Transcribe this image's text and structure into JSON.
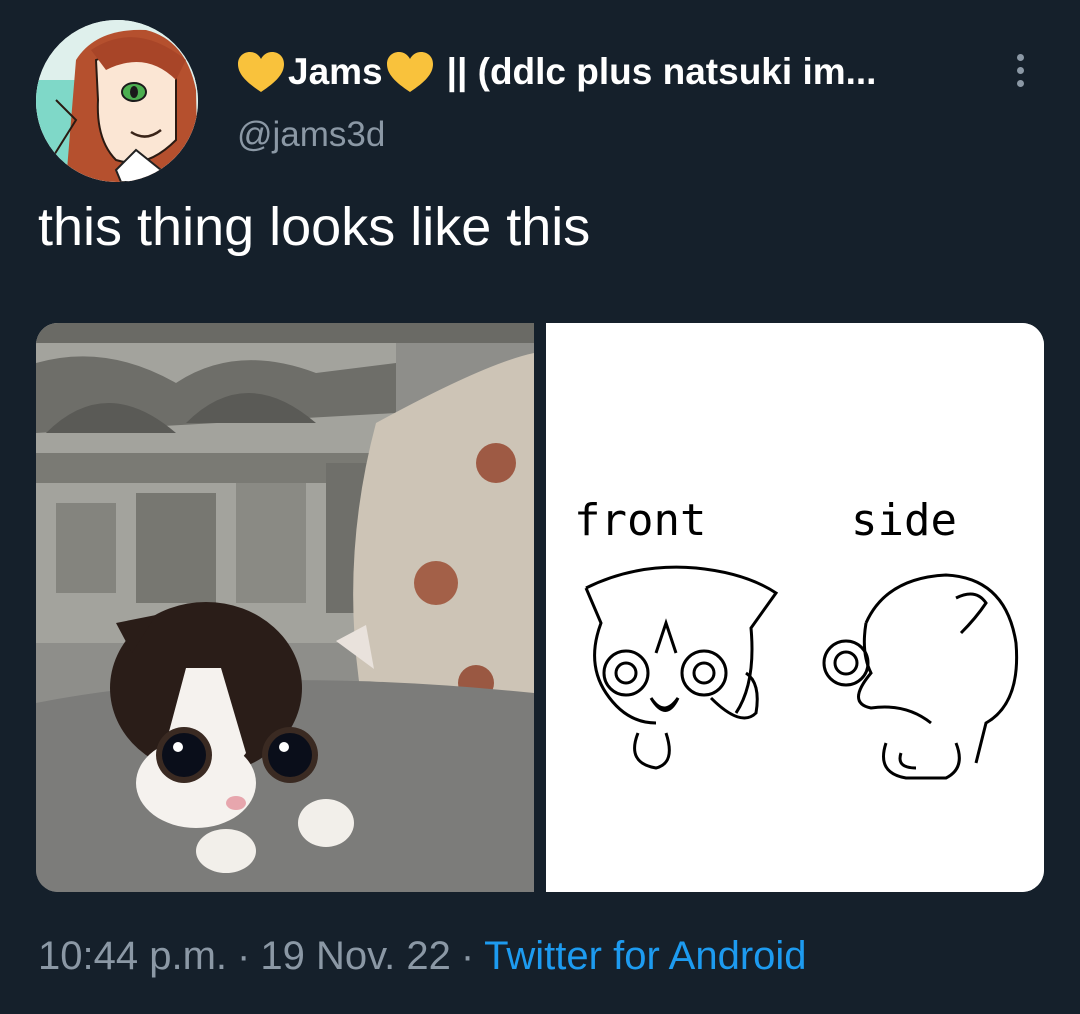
{
  "author": {
    "display_name": "Jams",
    "name_suffix": "|| (ddlc plus natsuki im...",
    "handle": "@jams3d",
    "heart_color": "#f9c23c",
    "avatar_icon": "anime-avatar"
  },
  "menu": {
    "icon": "more-vertical-icon"
  },
  "tweet": {
    "text": "this thing looks like this"
  },
  "media": {
    "left_photo": "kitten-photo",
    "right_drawing": {
      "label_front": "front",
      "label_side": "side"
    }
  },
  "meta": {
    "time": "10:44 p.m.",
    "separator": "·",
    "date": "19 Nov. 22",
    "source": "Twitter for Android",
    "source_color": "#1d9bf0"
  },
  "colors": {
    "background": "#15202b",
    "secondary_text": "#8b98a5"
  }
}
